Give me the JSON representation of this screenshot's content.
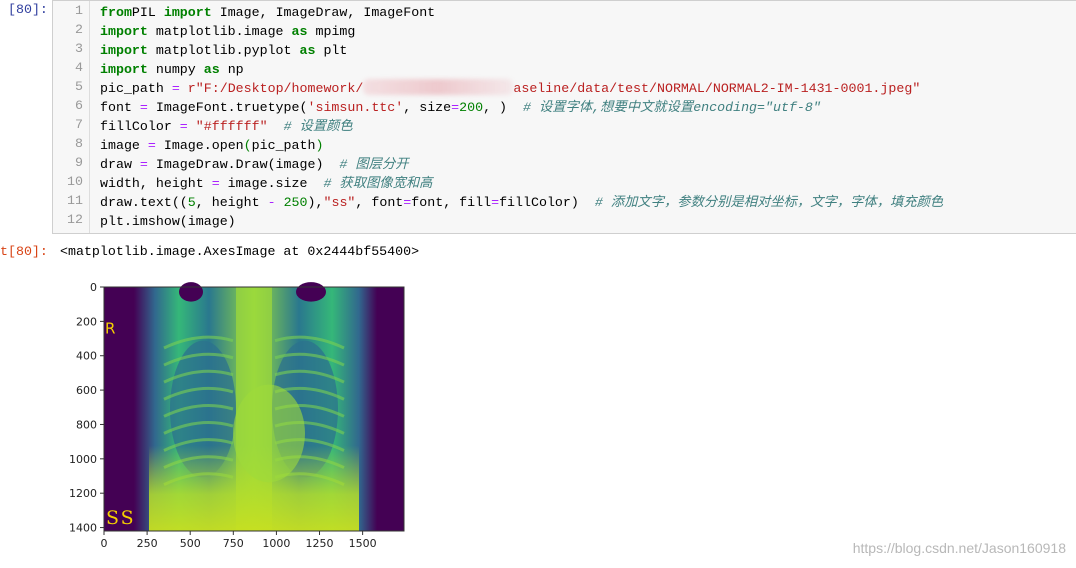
{
  "input_prompt": "[80]:",
  "output_prompt": "t[80]:",
  "output_text": "<matplotlib.image.AxesImage at 0x2444bf55400>",
  "code_lines": [
    [
      [
        "kw",
        "from"
      ],
      [
        "",
        "PIL "
      ],
      [
        "kw",
        "import"
      ],
      [
        "",
        " Image, ImageDraw, ImageFont"
      ]
    ],
    [
      [
        "kw",
        "import"
      ],
      [
        "",
        " matplotlib.image "
      ],
      [
        "kw",
        "as"
      ],
      [
        "",
        " mpimg"
      ]
    ],
    [
      [
        "kw",
        "import"
      ],
      [
        "",
        " matplotlib.pyplot "
      ],
      [
        "kw",
        "as"
      ],
      [
        "",
        " plt"
      ]
    ],
    [
      [
        "kw",
        "import"
      ],
      [
        "",
        " numpy "
      ],
      [
        "kw",
        "as"
      ],
      [
        "",
        " np"
      ]
    ],
    [
      [
        "",
        "pic_path "
      ],
      [
        "op",
        "="
      ],
      [
        "",
        " "
      ],
      [
        "str",
        "r\"F:/Desktop/homework/"
      ],
      [
        "blur",
        ""
      ],
      [
        "str",
        "aseline/data/test/NORMAL/NORMAL2-IM-1431-0001.jpeg\""
      ]
    ],
    [
      [
        "",
        "font "
      ],
      [
        "op",
        "="
      ],
      [
        "",
        " ImageFont.truetype("
      ],
      [
        "str",
        "'simsun.ttc'"
      ],
      [
        "",
        ", size"
      ],
      [
        "op",
        "="
      ],
      [
        "num",
        "200"
      ],
      [
        "",
        ", )  "
      ],
      [
        "cm",
        "# 设置字体,想要中文就设置encoding=\"utf-8\""
      ]
    ],
    [
      [
        "",
        "fillColor "
      ],
      [
        "op",
        "="
      ],
      [
        "",
        " "
      ],
      [
        "str",
        "\"#ffffff\""
      ],
      [
        "",
        "  "
      ],
      [
        "cm",
        "# 设置颜色"
      ]
    ],
    [
      [
        "",
        "image "
      ],
      [
        "op",
        "="
      ],
      [
        "",
        " Image.open"
      ],
      [
        "num",
        "("
      ],
      [
        "",
        "pic_path"
      ],
      [
        "num",
        ")"
      ]
    ],
    [
      [
        "",
        "draw "
      ],
      [
        "op",
        "="
      ],
      [
        "",
        " ImageDraw.Draw(image)  "
      ],
      [
        "cm",
        "# 图层分开"
      ]
    ],
    [
      [
        "",
        "width, height "
      ],
      [
        "op",
        "="
      ],
      [
        "",
        " image.size  "
      ],
      [
        "cm",
        "# 获取图像宽和高"
      ]
    ],
    [
      [
        "",
        "draw.text(("
      ],
      [
        "num",
        "5"
      ],
      [
        "",
        ", height "
      ],
      [
        "op",
        "-"
      ],
      [
        "",
        " "
      ],
      [
        "num",
        "250"
      ],
      [
        "",
        "),"
      ],
      [
        "str",
        "\"ss\""
      ],
      [
        "",
        ", font"
      ],
      [
        "op",
        "="
      ],
      [
        "",
        "font, fill"
      ],
      [
        "op",
        "="
      ],
      [
        "",
        "fillColor)  "
      ],
      [
        "cm",
        "# 添加文字，参数分别是相对坐标，文字，字体，填充颜色"
      ]
    ],
    [
      [
        "",
        "plt.imshow(image)"
      ]
    ]
  ],
  "chart_data": {
    "type": "image",
    "colormap": "viridis",
    "x_ticks": [
      0,
      250,
      500,
      750,
      1000,
      1250,
      1500
    ],
    "y_ticks": [
      0,
      200,
      400,
      600,
      800,
      1000,
      1200,
      1400
    ],
    "xlim": [
      0,
      1740
    ],
    "ylim": [
      1420,
      0
    ],
    "image_labels": [
      "R",
      "SS"
    ],
    "label_color": "#f5d000"
  },
  "watermark": "https://blog.csdn.net/Jason160918"
}
